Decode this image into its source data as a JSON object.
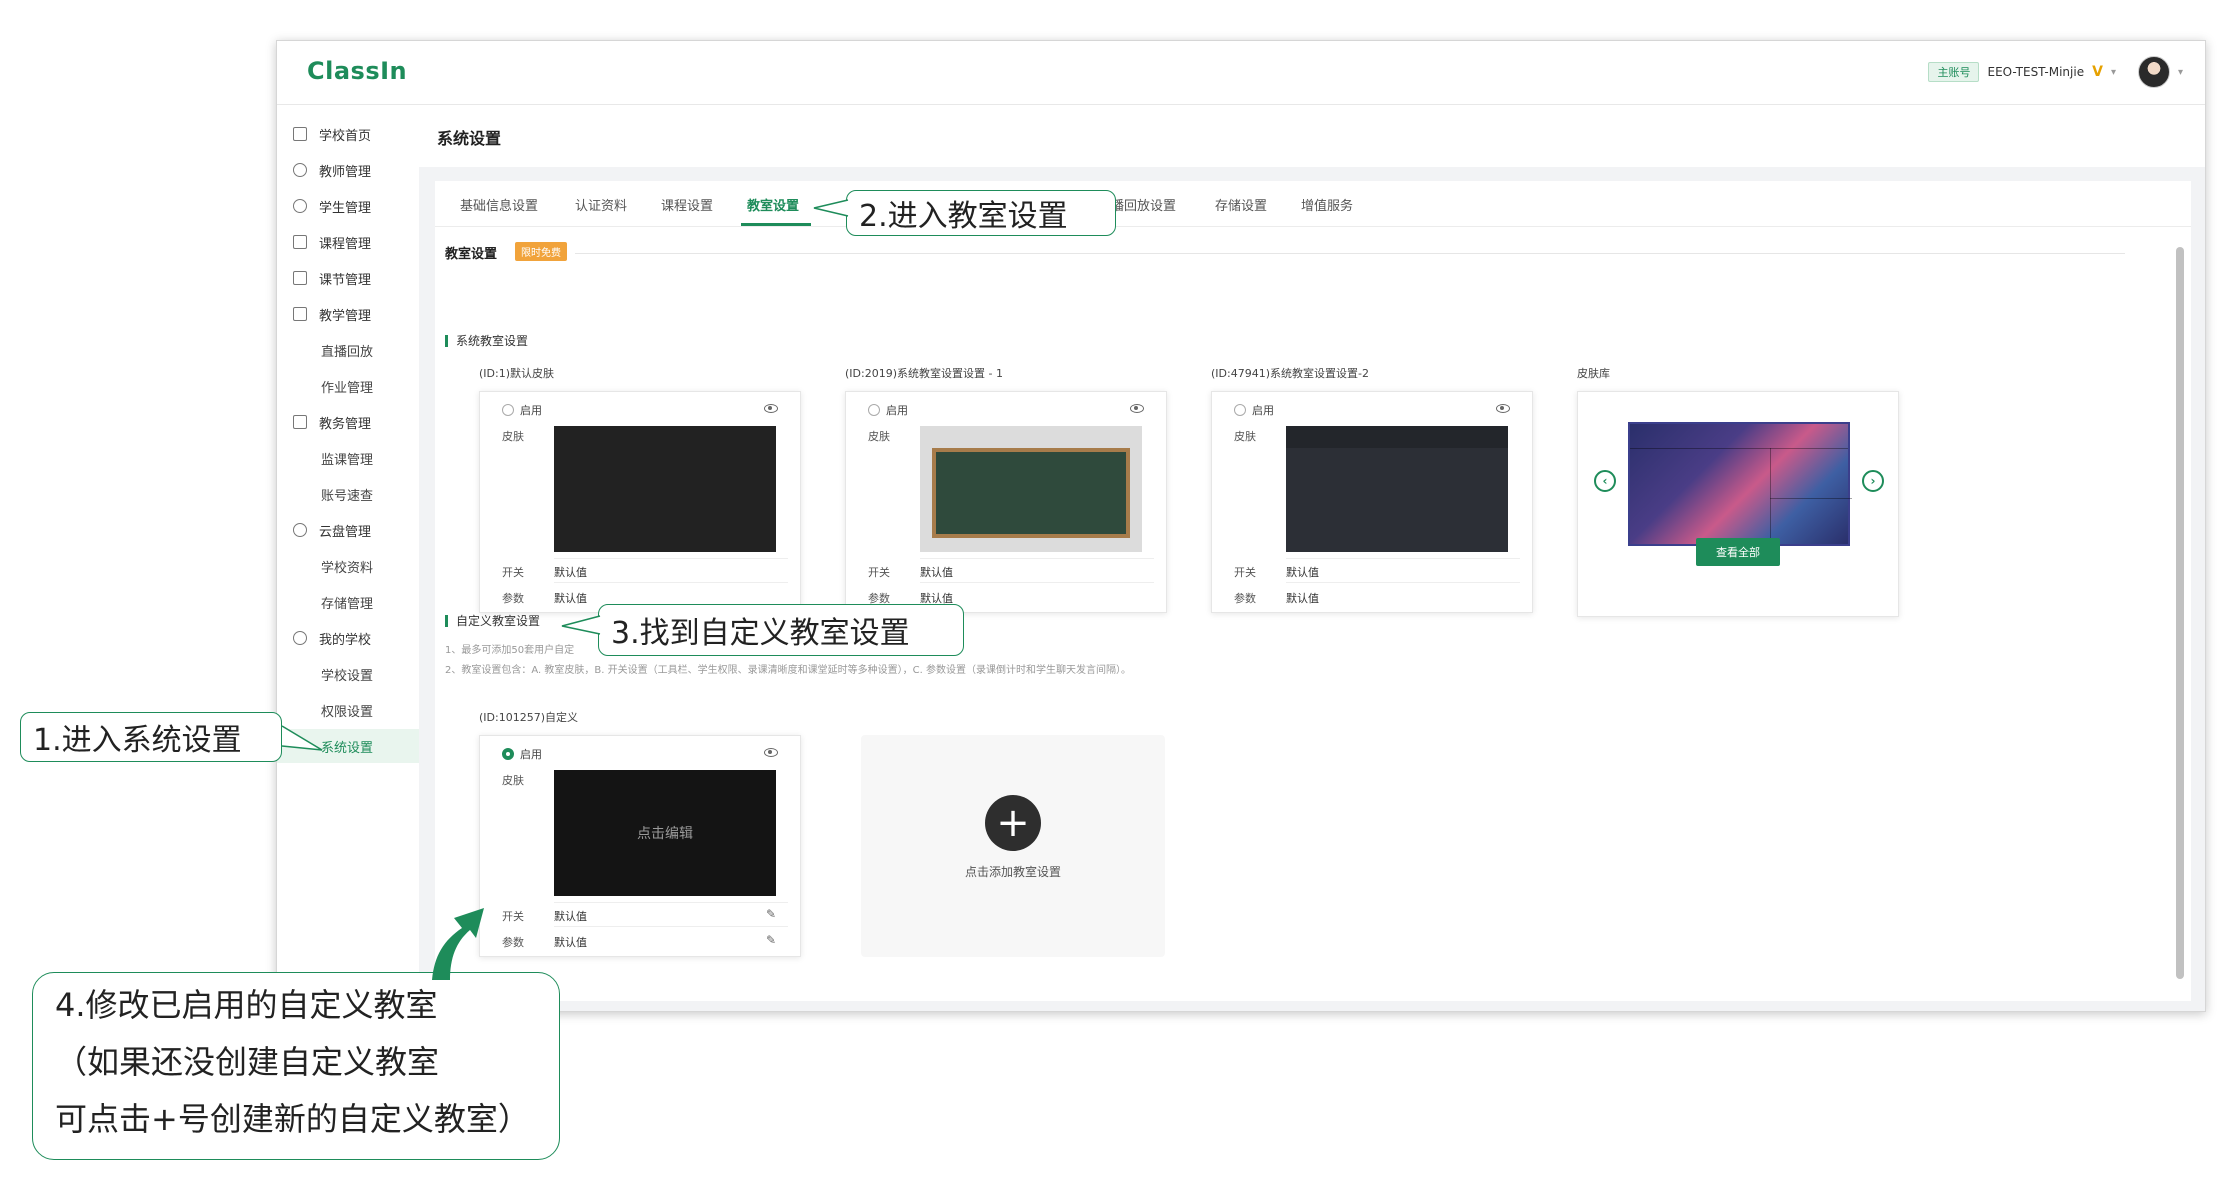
{
  "app": {
    "logo": "ClassIn",
    "account_badge": "主账号",
    "account_name": "EEO-TEST-Minjie",
    "vip_mark": "V"
  },
  "sidebar": {
    "items": [
      {
        "label": "学校首页",
        "icon": "home-icon",
        "level": 1
      },
      {
        "label": "教师管理",
        "icon": "user-icon",
        "level": 1
      },
      {
        "label": "学生管理",
        "icon": "student-icon",
        "level": 1
      },
      {
        "label": "课程管理",
        "icon": "course-icon",
        "level": 1
      },
      {
        "label": "课节管理",
        "icon": "lesson-icon",
        "level": 1
      },
      {
        "label": "教学管理",
        "icon": "teaching-icon",
        "level": 1
      },
      {
        "label": "直播回放",
        "level": 2
      },
      {
        "label": "作业管理",
        "level": 2
      },
      {
        "label": "教务管理",
        "icon": "admin-icon",
        "level": 1
      },
      {
        "label": "监课管理",
        "level": 2
      },
      {
        "label": "账号速查",
        "level": 2
      },
      {
        "label": "云盘管理",
        "icon": "cloud-icon",
        "level": 1
      },
      {
        "label": "学校资料",
        "level": 2
      },
      {
        "label": "存储管理",
        "level": 2
      },
      {
        "label": "我的学校",
        "icon": "school-icon",
        "level": 1
      },
      {
        "label": "学校设置",
        "level": 2
      },
      {
        "label": "权限设置",
        "level": 2
      },
      {
        "label": "系统设置",
        "level": 2,
        "active": true
      }
    ]
  },
  "page": {
    "title": "系统设置",
    "tabs": [
      "基础信息设置",
      "认证资料",
      "课程设置",
      "教室设置",
      "播回放设置",
      "存储设置",
      "增值服务"
    ],
    "active_tab": "教室设置"
  },
  "classroom": {
    "section_title": "教室设置",
    "limited_badge": "限时免费",
    "system_title": "系统教室设置",
    "enable_label": "启用",
    "skin_label": "皮肤",
    "switch_label": "开关",
    "param_label": "参数",
    "default_value": "默认值",
    "system_cards": [
      {
        "title": "(ID:1)默认皮肤",
        "skin": "dark"
      },
      {
        "title": "(ID:2019)系统教室设置设置 - 1",
        "skin": "chalkboard"
      },
      {
        "title": "(ID:47941)系统教室设置设置-2",
        "skin": "dark-header"
      }
    ],
    "skin_library": {
      "title": "皮肤库",
      "view_all": "查看全部"
    },
    "custom_title": "自定义教室设置",
    "notes": [
      "1、最多可添加50套用户自定",
      "2、教室设置包含：A. 教室皮肤，B. 开关设置（工具栏、学生权限、录课清晰度和课堂延时等多种设置），C. 参数设置（录课倒计时和学生聊天发言间隔）。"
    ],
    "custom_card": {
      "title": "(ID:101257)自定义",
      "edit_text": "点击编辑",
      "enabled": true
    },
    "add_label": "点击添加教室设置"
  },
  "callouts": {
    "step1": "1.进入系统设置",
    "step2": "2.进入教室设置",
    "step3": "3.找到自定义教室设置",
    "step4_lines": [
      "4.修改已启用的自定义教室",
      "（如果还没创建自定义教室",
      "可点击+号创建新的自定义教室）"
    ]
  },
  "colors": {
    "brand": "#1e8c5a",
    "badge": "#f1a33b"
  }
}
